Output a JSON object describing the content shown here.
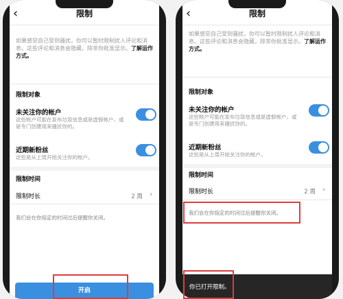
{
  "screen_title": "限制",
  "back_icon": "‹",
  "intro_text": "如果感觉自己受到骚扰，你可以暂时限制扰人评论和消息。这些评论和消息会隐藏，除非你批准显示。",
  "intro_link": "了解运作方式。",
  "restrict_section_title": "限制对象",
  "non_followers": {
    "title": "未关注你的帐户",
    "desc": "这些帐户可能在发布垃圾信息或是虚假帐户，或是专门创建用来骚扰你的。",
    "enabled": true
  },
  "new_followers": {
    "title": "近期新粉丝",
    "desc": "这些是从上周开始关注你的帐户。",
    "enabled": true
  },
  "time_section_title": "限制时间",
  "duration": {
    "label": "限制时长",
    "value": "2 周",
    "chevron": "›"
  },
  "reminder_note": "我们会在你指定的时间过后提醒你关闭。",
  "enable_button": "开启",
  "toast_text": "你已打开限制。",
  "colors": {
    "accent": "#3b8fe0",
    "highlight_box": "#e03b3b",
    "toast_bg": "#262626"
  }
}
